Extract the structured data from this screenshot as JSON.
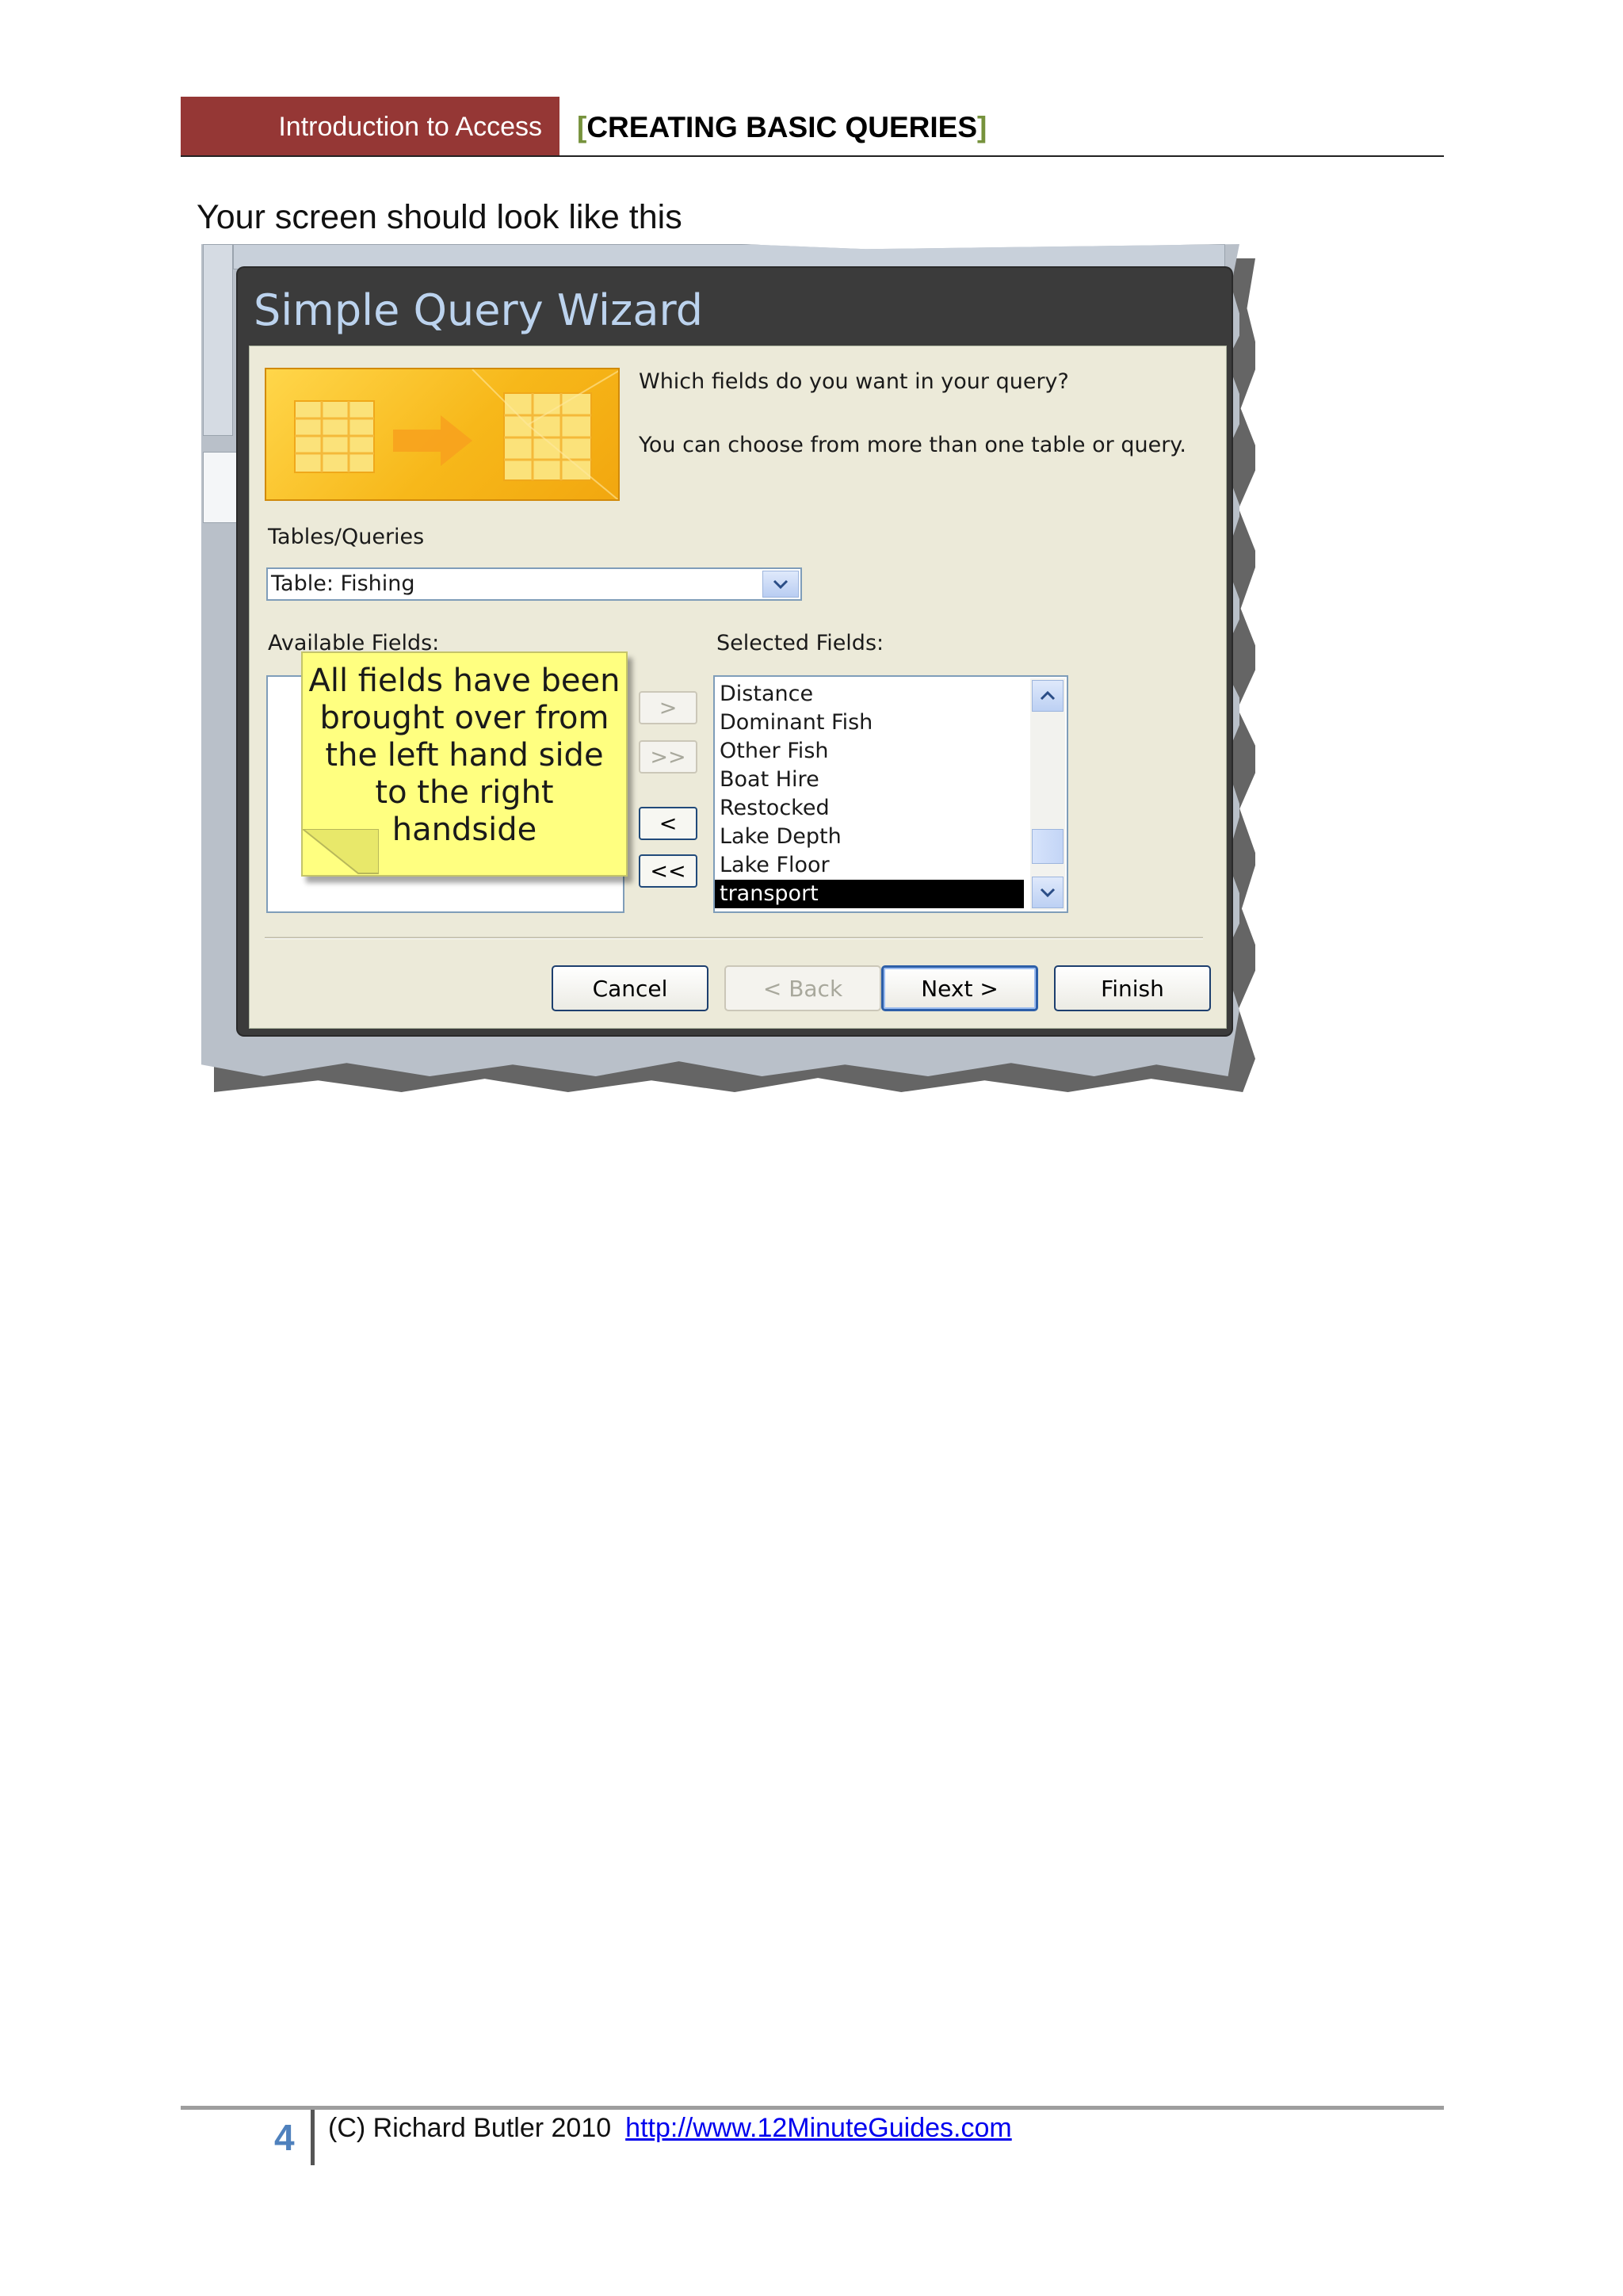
{
  "header": {
    "tab_label": "Introduction to Access",
    "title_open": "[",
    "title": "CREATING BASIC QUERIES",
    "title_close": "]"
  },
  "intro_text": "Your screen should look like this",
  "dialog": {
    "title": "Simple Query Wizard",
    "question": "Which fields do you want in your query?",
    "hint": "You can choose from more than one table or query.",
    "tables_label": "Tables/Queries",
    "tables_value": "Table: Fishing",
    "available_label": "Available Fields:",
    "selected_label": "Selected Fields:",
    "selected_fields": [
      "Distance",
      "Dominant Fish",
      "Other Fish",
      "Boat Hire",
      "Restocked",
      "Lake Depth",
      "Lake Floor",
      "transport"
    ],
    "selected_item": "transport",
    "move_buttons": {
      "add_one": ">",
      "add_all": ">>",
      "remove_one": "<",
      "remove_all": "<<"
    },
    "buttons": {
      "cancel": "Cancel",
      "back": "< Back",
      "next": "Next >",
      "finish": "Finish"
    }
  },
  "callout": {
    "text": "All fields have been brought over from the left hand side to the right handside"
  },
  "footer": {
    "page_number": "4",
    "copyright": "(C) Richard Butler 2010",
    "url": "http://www.12MinuteGuides.com"
  },
  "colors": {
    "header_tab_bg": "#953735",
    "title_bracket": "#76923c",
    "page_number": "#4f81bd",
    "dialog_title": "#bcd3ee",
    "callout_bg": "#ffff80"
  }
}
